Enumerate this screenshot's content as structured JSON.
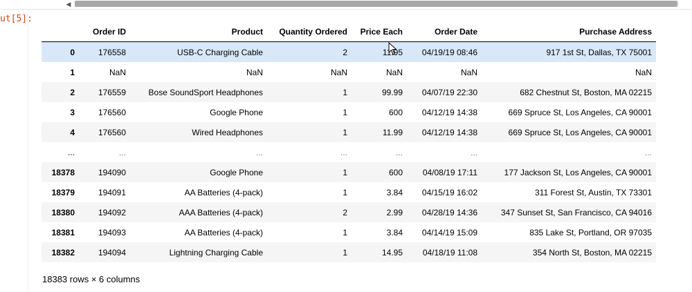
{
  "prompt_label": "ut[5]:",
  "columns": [
    "",
    "Order ID",
    "Product",
    "Quantity Ordered",
    "Price Each",
    "Order Date",
    "Purchase Address"
  ],
  "rows": [
    {
      "index": "0",
      "cells": [
        "176558",
        "USB-C Charging Cable",
        "2",
        "11.95",
        "04/19/19 08:46",
        "917 1st St, Dallas, TX 75001"
      ],
      "highlight": true
    },
    {
      "index": "1",
      "cells": [
        "NaN",
        "NaN",
        "NaN",
        "NaN",
        "NaN",
        "NaN"
      ]
    },
    {
      "index": "2",
      "cells": [
        "176559",
        "Bose SoundSport Headphones",
        "1",
        "99.99",
        "04/07/19 22:30",
        "682 Chestnut St, Boston, MA 02215"
      ]
    },
    {
      "index": "3",
      "cells": [
        "176560",
        "Google Phone",
        "1",
        "600",
        "04/12/19 14:38",
        "669 Spruce St, Los Angeles, CA 90001"
      ]
    },
    {
      "index": "4",
      "cells": [
        "176560",
        "Wired Headphones",
        "1",
        "11.99",
        "04/12/19 14:38",
        "669 Spruce St, Los Angeles, CA 90001"
      ]
    },
    {
      "index": "...",
      "cells": [
        "...",
        "...",
        "...",
        "...",
        "...",
        "..."
      ],
      "ellipsis": true
    },
    {
      "index": "18378",
      "cells": [
        "194090",
        "Google Phone",
        "1",
        "600",
        "04/08/19 17:11",
        "177 Jackson St, Los Angeles, CA 90001"
      ]
    },
    {
      "index": "18379",
      "cells": [
        "194091",
        "AA Batteries (4-pack)",
        "1",
        "3.84",
        "04/15/19 16:02",
        "311 Forest St, Austin, TX 73301"
      ]
    },
    {
      "index": "18380",
      "cells": [
        "194092",
        "AAA Batteries (4-pack)",
        "2",
        "2.99",
        "04/28/19 14:36",
        "347 Sunset St, San Francisco, CA 94016"
      ]
    },
    {
      "index": "18381",
      "cells": [
        "194093",
        "AA Batteries (4-pack)",
        "1",
        "3.84",
        "04/14/19 15:09",
        "835 Lake St, Portland, OR 97035"
      ]
    },
    {
      "index": "18382",
      "cells": [
        "194094",
        "Lightning Charging Cable",
        "1",
        "14.95",
        "04/18/19 11:08",
        "354 North St, Boston, MA 02215"
      ]
    }
  ],
  "shape_text": "18383 rows × 6 columns"
}
